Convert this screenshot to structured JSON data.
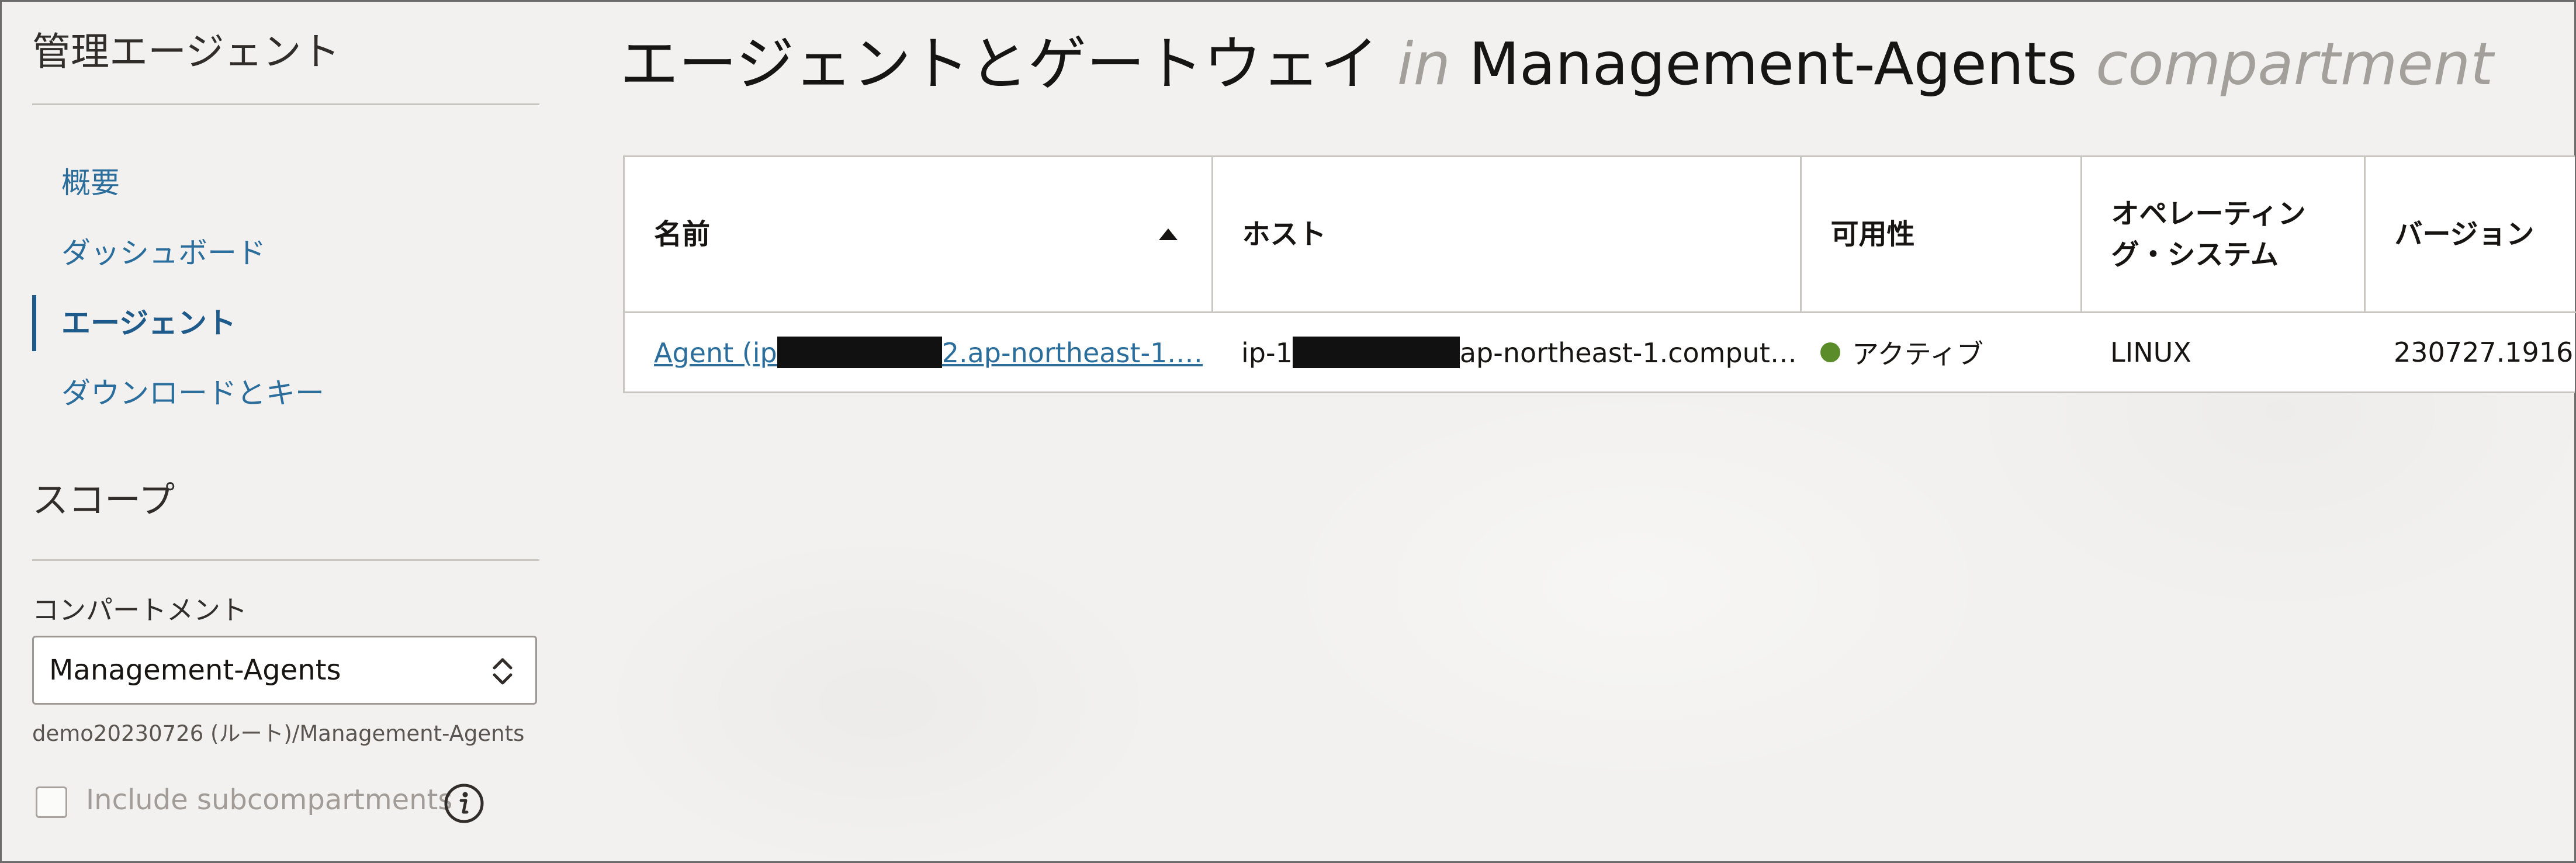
{
  "sidebar": {
    "title": "管理エージェント",
    "nav": [
      {
        "label": "概要",
        "active": false
      },
      {
        "label": "ダッシュボード",
        "active": false
      },
      {
        "label": "エージェント",
        "active": true
      },
      {
        "label": "ダウンロードとキー",
        "active": false
      }
    ],
    "scope_title": "スコープ",
    "compartment_label": "コンパートメント",
    "compartment_value": "Management-Agents",
    "compartment_path": "demo20230726 (ルート)/Management-Agents",
    "include_sub_label": "Include subcompartments",
    "include_sub_checked": false
  },
  "main": {
    "title_main": "エージェントとゲートウェイ",
    "title_in": "in",
    "title_compartment": "Management-Agents",
    "title_suffix": "compartment"
  },
  "table": {
    "columns": [
      "名前",
      "ホスト",
      "可用性",
      "オペレーティング・システム",
      "バージョン"
    ],
    "sort": {
      "column": "名前",
      "direction": "ascending"
    },
    "rows": [
      {
        "name_prefix": "Agent (ip",
        "name_suffix": "2.ap-northeast-1.…",
        "host_prefix": "ip-1",
        "host_suffix": "ap-northeast-1.comput…",
        "availability": "アクティブ",
        "os": "LINUX",
        "version": "230727.1916"
      }
    ]
  },
  "colors": {
    "link": "#2b6e9c",
    "active_status": "#5b8c2a",
    "faint_title": "#a3a09c"
  }
}
